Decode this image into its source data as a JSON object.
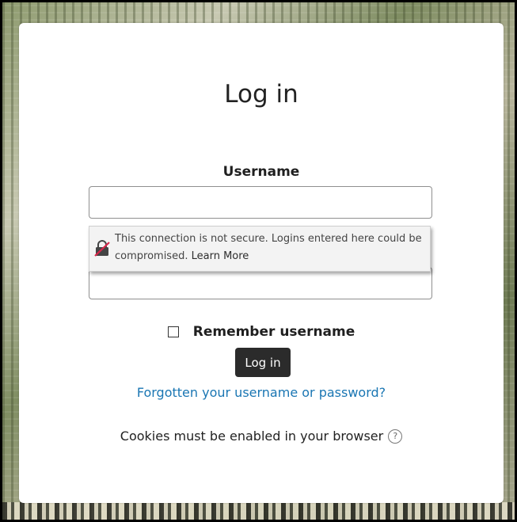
{
  "title": "Log in",
  "username": {
    "label": "Username",
    "value": "",
    "placeholder": ""
  },
  "password": {
    "value": "",
    "placeholder": ""
  },
  "security_warning": {
    "message": "This connection is not secure. Logins entered here could be compromised.",
    "learn_more": "Learn More",
    "icon": "insecure-lock-icon",
    "icon_slash_color": "#d7264a"
  },
  "remember": {
    "label": "Remember username",
    "checked": false
  },
  "login_button": {
    "label": "Log in",
    "color": "#2b2b2b"
  },
  "forgot_link": {
    "label": "Forgotten your username or password?",
    "color": "#1a76b3"
  },
  "cookies": {
    "text": "Cookies must be enabled in your browser",
    "help_icon": "question-circle-icon",
    "help_glyph": "?"
  }
}
